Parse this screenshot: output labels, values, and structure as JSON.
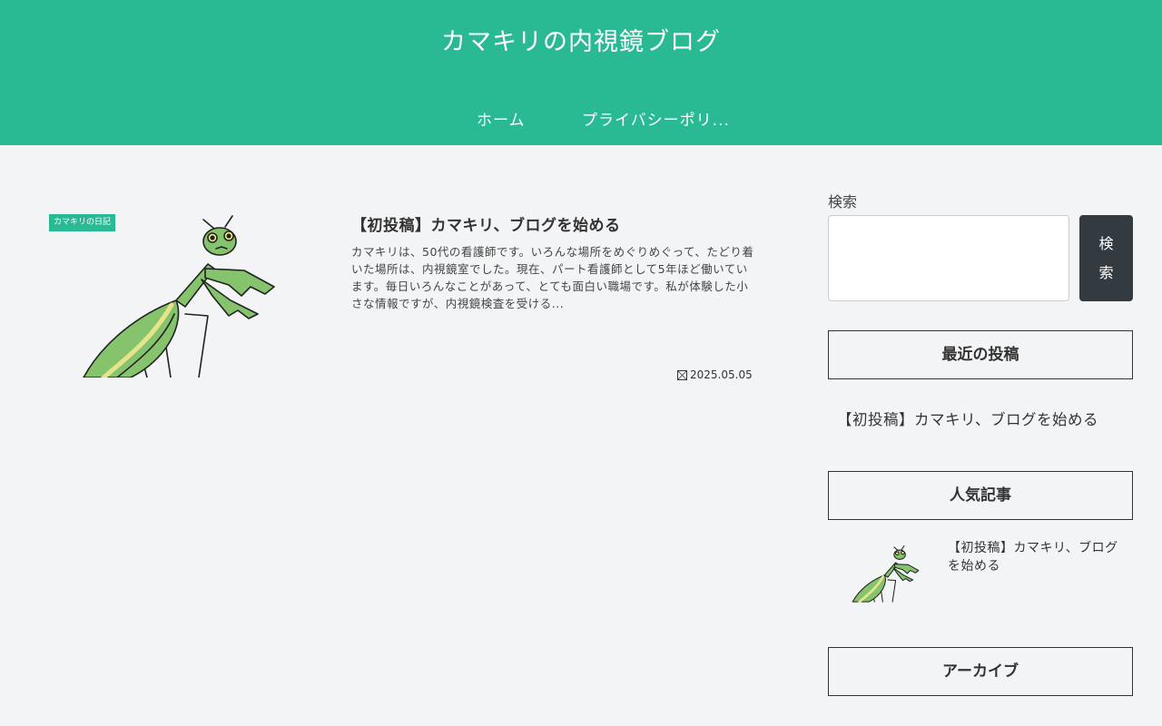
{
  "header": {
    "site_title": "カマキリの内視鏡ブログ",
    "nav": [
      {
        "label": "ホーム"
      },
      {
        "label": "プライバシーポリ..."
      }
    ],
    "bg_color": "#29b993"
  },
  "main": {
    "post": {
      "category": "カマキリの日記",
      "title": "【初投稿】カマキリ、ブログを始める",
      "snippet": "カマキリは、50代の看護師です。いろんな場所をめぐりめぐって、たどり着いた場所は、内視鏡室でした。現在、パート看護師として5年ほど働いています。毎日いろんなことがあって、とても面白い職場です。私が体験した小さな情報ですが、内視鏡検査を受ける...",
      "date": "2025.05.05",
      "thumbnail_icon": "mantis-illustration"
    }
  },
  "sidebar": {
    "search": {
      "label": "検索",
      "value": "",
      "button_label": "検索"
    },
    "recent": {
      "title": "最近の投稿",
      "items": [
        "【初投稿】カマキリ、ブログを始める"
      ]
    },
    "popular": {
      "title": "人気記事",
      "items": [
        {
          "title": "【初投稿】カマキリ、ブログを始める"
        }
      ]
    },
    "archive": {
      "title": "アーカイブ"
    }
  }
}
